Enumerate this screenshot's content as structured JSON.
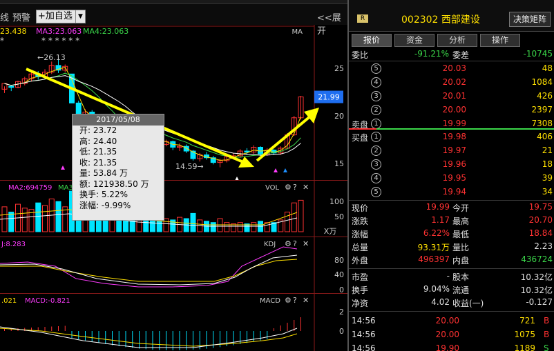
{
  "toolbar": {
    "items": [
      "线",
      "预警"
    ],
    "add_favorite": "+加自选",
    "expand": "<<展开"
  },
  "main_chart": {
    "ma_legend": [
      {
        "text": "23.438",
        "color": "#ffe000"
      },
      {
        "text": "MA3:23.063",
        "color": "#ff3cff"
      },
      {
        "text": "MA4:23.063",
        "color": "#3bd94a"
      }
    ],
    "ma_label": "MA",
    "star_markers": "* * * * *  *",
    "high_label": "←26.13",
    "low_label": "14.59→",
    "price_ticks": [
      "25",
      "20",
      "15"
    ],
    "current_price": "21.99"
  },
  "tooltip": {
    "date": "2017/05/08",
    "rows": [
      "开: 23.72",
      "高: 24.40",
      "低: 21.35",
      "收: 21.35",
      "量: 53.84 万",
      "额: 121938.50 万",
      "换手: 5.22%",
      "涨幅: -9.99%"
    ]
  },
  "vol_panel": {
    "legend": "MA2:694759",
    "legend2": "MA3",
    "title": "VOL",
    "ticks": [
      "100",
      "50",
      "X万"
    ]
  },
  "kdj_panel": {
    "legend": "J:8.283",
    "title": "KDJ",
    "ticks": [
      "80",
      "40",
      "0"
    ]
  },
  "macd_panel": {
    "legend": ".021",
    "legend2": "MACD:-0.821",
    "title": "MACD",
    "ticks": [
      "2",
      "0"
    ]
  },
  "stock": {
    "badge": "R",
    "code_name": "002302 西部建设",
    "decision_button": "决策矩阵"
  },
  "tabs": [
    "报价",
    "资金",
    "分析",
    "操作"
  ],
  "order_book": {
    "wei_bi_label": "委比",
    "wei_bi": "-91.21%",
    "wei_cha_label": "委差",
    "wei_cha": "-10745",
    "sell_label": "卖盘",
    "buy_label": "买盘",
    "sell": [
      {
        "n": "5",
        "price": "20.03",
        "vol": "48"
      },
      {
        "n": "4",
        "price": "20.02",
        "vol": "1084"
      },
      {
        "n": "3",
        "price": "20.01",
        "vol": "426"
      },
      {
        "n": "2",
        "price": "20.00",
        "vol": "2397"
      },
      {
        "n": "1",
        "price": "19.99",
        "vol": "7308"
      }
    ],
    "buy": [
      {
        "n": "1",
        "price": "19.98",
        "vol": "406"
      },
      {
        "n": "2",
        "price": "19.97",
        "vol": "21"
      },
      {
        "n": "3",
        "price": "19.96",
        "vol": "18"
      },
      {
        "n": "4",
        "price": "19.95",
        "vol": "39"
      },
      {
        "n": "5",
        "price": "19.94",
        "vol": "34"
      }
    ]
  },
  "quote": {
    "rows": [
      [
        {
          "l": "现价",
          "v": "19.99",
          "c": "red"
        },
        {
          "l": "今开",
          "v": "19.75",
          "c": "red"
        }
      ],
      [
        {
          "l": "涨跌",
          "v": "1.17",
          "c": "red"
        },
        {
          "l": "最高",
          "v": "20.70",
          "c": "red"
        }
      ],
      [
        {
          "l": "涨幅",
          "v": "6.22%",
          "c": "red"
        },
        {
          "l": "最低",
          "v": "18.84",
          "c": "red"
        }
      ],
      [
        {
          "l": "总量",
          "v": "93.31万",
          "c": "ylw"
        },
        {
          "l": "量比",
          "v": "2.23",
          "c": "wht"
        }
      ],
      [
        {
          "l": "外盘",
          "v": "496397",
          "c": "red"
        },
        {
          "l": "内盘",
          "v": "436724",
          "c": "grn"
        }
      ]
    ],
    "rows2": [
      [
        {
          "l": "市盈",
          "v": "-",
          "c": "wht"
        },
        {
          "l": "股本",
          "v": "10.32亿",
          "c": "wht"
        }
      ],
      [
        {
          "l": "换手",
          "v": "9.04%",
          "c": "wht"
        },
        {
          "l": "流通",
          "v": "10.32亿",
          "c": "wht"
        }
      ],
      [
        {
          "l": "净资",
          "v": "4.02",
          "c": "wht"
        },
        {
          "l": "收益(一)",
          "v": "-0.127",
          "c": "wht"
        }
      ]
    ]
  },
  "ticks": [
    {
      "time": "14:56",
      "price": "20.00",
      "vol": "721",
      "flag": "B"
    },
    {
      "time": "14:56",
      "price": "20.00",
      "vol": "1075",
      "flag": "B"
    },
    {
      "time": "14:56",
      "price": "19.90",
      "vol": "1189",
      "flag": "S"
    }
  ],
  "colors": {
    "up": "#ff3232",
    "down": "#00e5ff",
    "ma_yellow": "#ffe000",
    "ma_green": "#3bd94a",
    "ma_pink": "#ff3cff",
    "arrow": "#ffff00",
    "separator": "#8b1a1a"
  }
}
